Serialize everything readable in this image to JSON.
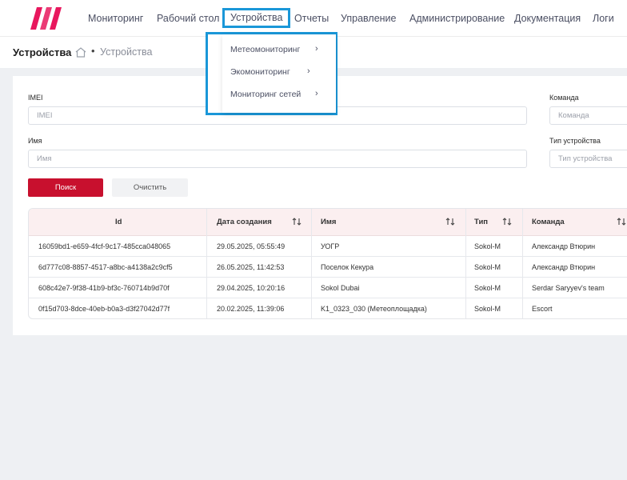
{
  "nav": {
    "items": [
      "Мониторинг",
      "Рабочий стол",
      "Устройства",
      "Отчеты",
      "Управление",
      "Администрирование",
      "Документация",
      "Логи"
    ]
  },
  "breadcrumb": {
    "title": "Устройства",
    "separator": "•",
    "current": "Устройства"
  },
  "filters": {
    "imei_label": "IMEI",
    "imei_placeholder": "IMEI",
    "name_label": "Имя",
    "name_placeholder": "Имя",
    "team_label": "Команда",
    "team_placeholder": "Команда",
    "type_label": "Тип устройства",
    "type_placeholder": "Тип устройства",
    "search_label": "Поиск",
    "clear_label": "Очистить"
  },
  "table": {
    "headers": [
      "Id",
      "Дата создания",
      "Имя",
      "Тип",
      "Команда"
    ],
    "rows": [
      [
        "16059bd1-e659-4fcf-9c17-485cca048065",
        "29.05.2025, 05:55:49",
        "УОГР",
        "Sokol-M",
        "Александр Втюрин"
      ],
      [
        "6d777c08-8857-4517-a8bc-a4138a2c9cf5",
        "26.05.2025, 11:42:53",
        "Поселок Кекура",
        "Sokol-M",
        "Александр Втюрин"
      ],
      [
        "608c42e7-9f38-41b9-bf3c-760714b9d70f",
        "29.04.2025, 10:20:16",
        "Sokol Dubai",
        "Sokol-M",
        "Serdar Saryyev's team"
      ],
      [
        "0f15d703-8dce-40eb-b0a3-d3f27042d77f",
        "20.02.2025, 11:39:06",
        "K1_0323_030 (Метеоплощадка)",
        "Sokol-M",
        "Escort"
      ]
    ]
  },
  "dropdown": {
    "items": [
      "Метеомониторинг",
      "Экомониторинг",
      "Мониторинг сетей"
    ]
  },
  "colors": {
    "brand": "#e8175d",
    "accent": "#c8102e",
    "highlight": "#1a97d8"
  }
}
